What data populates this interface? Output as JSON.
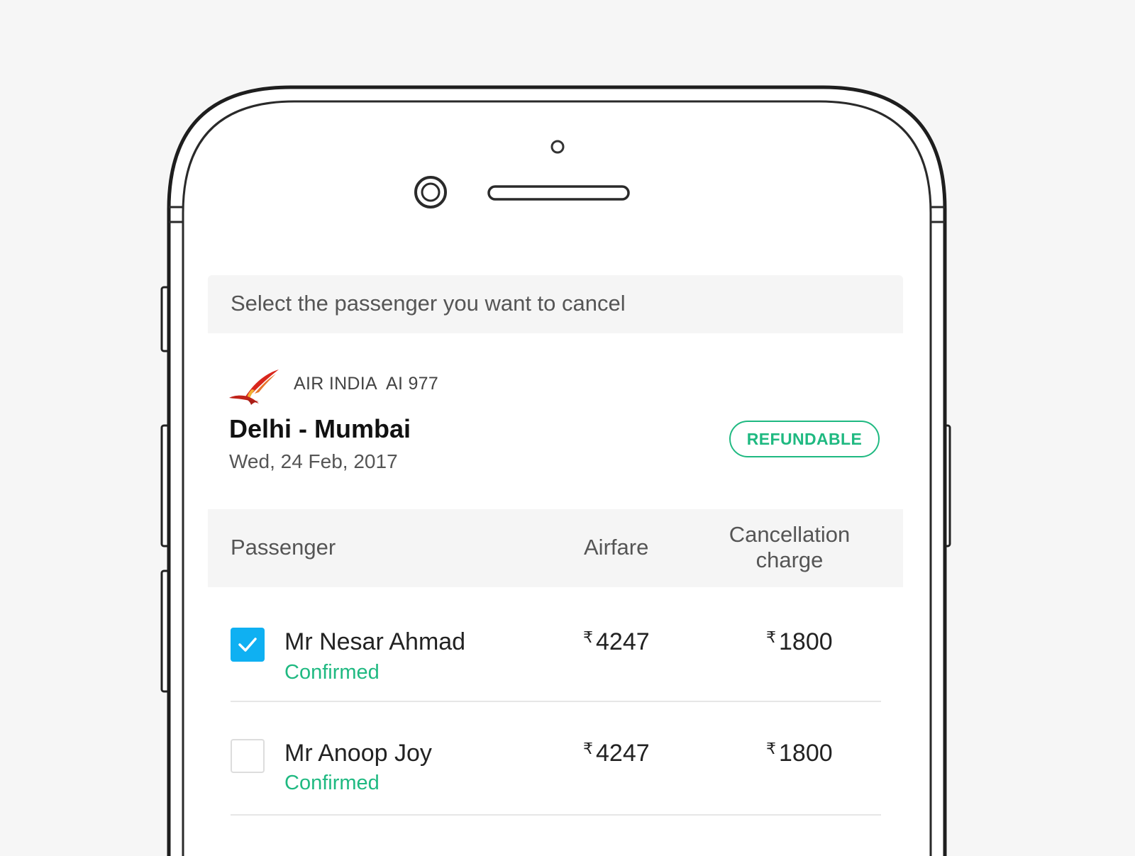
{
  "instruction": "Select the passenger you want to cancel",
  "flight": {
    "airline": "AIR INDIA",
    "flight_number": "AI 977",
    "route": "Delhi - Mumbai",
    "date": "Wed, 24 Feb, 2017",
    "fare_type": "REFUNDABLE",
    "logo_icon": "air-india-logo"
  },
  "table": {
    "headers": {
      "passenger": "Passenger",
      "airfare": "Airfare",
      "charge_line1": "Cancellation",
      "charge_line2": "charge"
    },
    "currency_symbol": "₹",
    "rows": [
      {
        "name": "Mr Nesar Ahmad",
        "status": "Confirmed",
        "airfare": "4247",
        "charge": "1800",
        "selected": true
      },
      {
        "name": "Mr Anoop Joy",
        "status": "Confirmed",
        "airfare": "4247",
        "charge": "1800",
        "selected": false
      }
    ]
  },
  "colors": {
    "accent_green": "#1fb981",
    "checkbox_blue": "#0fb0f2",
    "header_bg": "#f5f5f5"
  }
}
